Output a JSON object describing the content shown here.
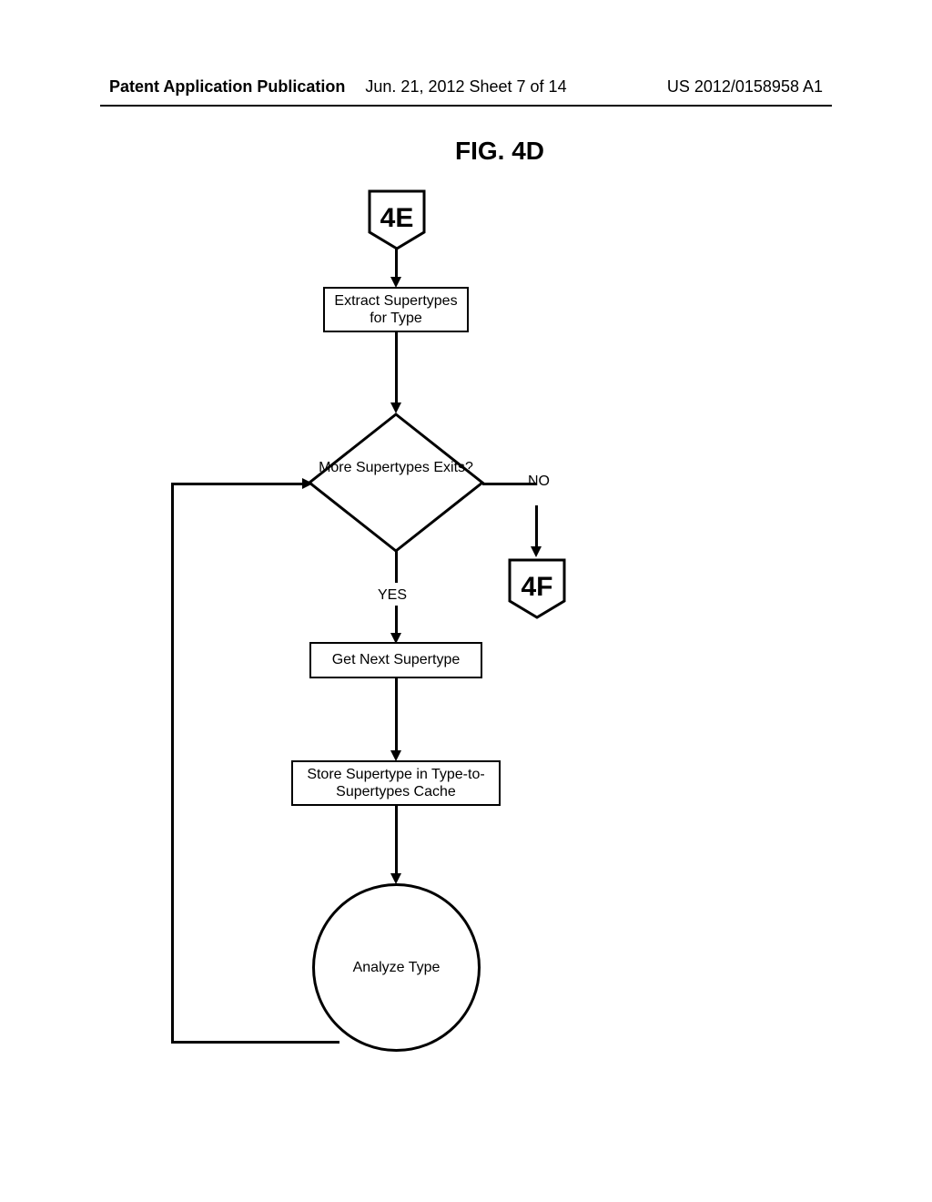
{
  "header": {
    "left": "Patent Application Publication",
    "center": "Jun. 21, 2012  Sheet 7 of 14",
    "right": "US 2012/0158958 A1"
  },
  "figure_title": "FIG. 4D",
  "flowchart": {
    "connector_in": "4E",
    "connector_out": "4F",
    "box_extract": "Extract Supertypes for Type",
    "decision": "More Supertypes Exits?",
    "label_yes": "YES",
    "label_no": "NO",
    "box_getnext": "Get Next Supertype",
    "box_store": "Store Supertype in Type-to-Supertypes Cache",
    "circle_analyze": "Analyze Type"
  }
}
